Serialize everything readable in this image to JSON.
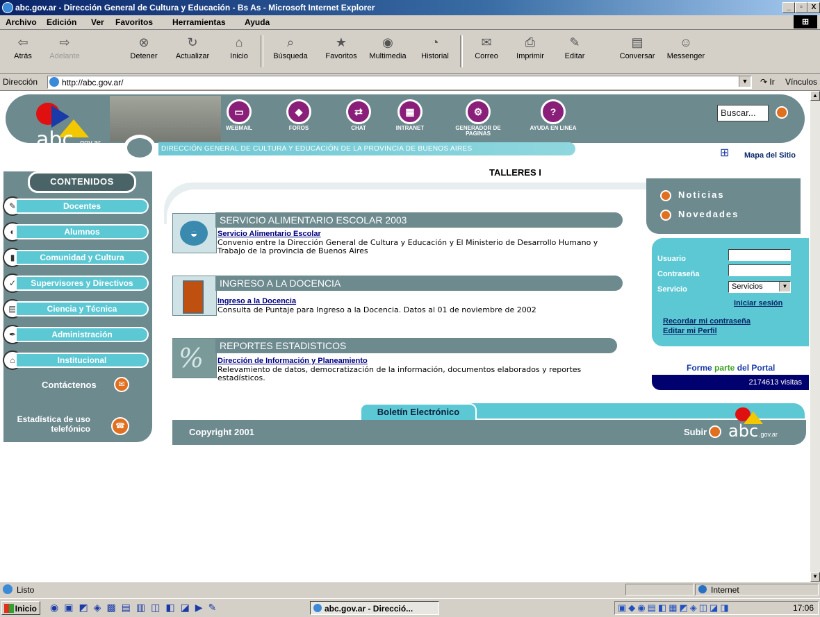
{
  "window": {
    "title": "abc.gov.ar - Dirección General de Cultura y Educación - Bs As - Microsoft Internet Explorer",
    "controls": [
      "_",
      "▫",
      "X"
    ]
  },
  "menu": [
    "Archivo",
    "Edición",
    "Ver",
    "Favoritos",
    "Herramientas",
    "Ayuda"
  ],
  "toolbar": [
    {
      "label": "Atrás",
      "icon": "back-arrow-icon"
    },
    {
      "label": "Adelante",
      "icon": "forward-arrow-icon"
    },
    {
      "label": "Detener",
      "icon": "stop-icon"
    },
    {
      "label": "Actualizar",
      "icon": "refresh-icon"
    },
    {
      "label": "Inicio",
      "icon": "home-icon"
    },
    {
      "label": "Búsqueda",
      "icon": "search-icon"
    },
    {
      "label": "Favoritos",
      "icon": "favorites-icon"
    },
    {
      "label": "Multimedia",
      "icon": "media-icon"
    },
    {
      "label": "Historial",
      "icon": "history-icon"
    },
    {
      "label": "Correo",
      "icon": "mail-icon"
    },
    {
      "label": "Imprimir",
      "icon": "print-icon"
    },
    {
      "label": "Editar",
      "icon": "edit-icon"
    },
    {
      "label": "Conversar",
      "icon": "discuss-icon"
    },
    {
      "label": "Messenger",
      "icon": "messenger-icon"
    }
  ],
  "address": {
    "label": "Dirección",
    "url": "http://abc.gov.ar/",
    "go": "Ir",
    "links": "Vínculos"
  },
  "header": {
    "logo": "abc",
    "logo_suffix": ".gov.ar",
    "tagline": "DIRECCIÓN GENERAL DE CULTURA Y EDUCACIÓN DE LA PROVINCIA DE BUENOS AIRES",
    "icons": [
      "WEBMAIL",
      "FOROS",
      "CHAT",
      "INTRANET",
      "GENERADOR DE PAGINAS",
      "AYUDA EN LINEA"
    ],
    "search_placeholder": "Buscar...",
    "sitemap": "Mapa del Sitio",
    "marquee": "TALLERES I"
  },
  "sidebar": {
    "title": "CONTENIDOS",
    "items": [
      "Docentes",
      "Alumnos",
      "Comunidad y Cultura",
      "Supervisores y Directivos",
      "Ciencia y Técnica",
      "Administración",
      "Institucional"
    ],
    "contact": "Contáctenos",
    "phone_stats": "Estadística de uso telefónico"
  },
  "sections": [
    {
      "title": "SERVICIO ALIMENTARIO ESCOLAR 2003",
      "link": "Servicio Alimentario Escolar",
      "desc": "Convenio entre la Dirección General de Cultura y Educación y El Ministerio de Desarrollo Humano y Trabajo de la provincia de Buenos Aires"
    },
    {
      "title": "INGRESO A LA DOCENCIA",
      "link": "Ingreso a la Docencia",
      "desc": "Consulta de Puntaje para Ingreso a la Docencia. Datos al 01 de noviembre de 2002"
    },
    {
      "title": "REPORTES ESTADISTICOS",
      "link": "Dirección de Información y Planeamiento",
      "desc": "Relevamiento de datos, democratización de la información, documentos elaborados y reportes estadísticos."
    }
  ],
  "right": {
    "noticias": "Noticias",
    "novedades": "Novedades",
    "usuario": "Usuario",
    "contrasena": "Contraseña",
    "servicio": "Servicio",
    "servicio_value": "Servicios",
    "iniciar": "Iniciar sesión",
    "recordar": "Recordar mi contraseña",
    "editar": "Editar mi Perfil",
    "forme_a": "Forme ",
    "forme_b": "parte",
    "forme_c": " del Portal",
    "visits": "2174613 visitas"
  },
  "footer": {
    "boletin": "Boletín Electrónico",
    "copyright": "Copyright 2001",
    "subir": "Subir"
  },
  "status": {
    "text": "Listo",
    "zone": "Internet"
  },
  "taskbar": {
    "start": "Inicio",
    "task": "abc.gov.ar - Direcció...",
    "clock": "17:06"
  },
  "colors": {
    "teal": "#6d8a8f",
    "cyan": "#5cc8d4",
    "accent_orange": "#e07020",
    "purple": "#8a1f7a",
    "navy": "#00006e"
  }
}
